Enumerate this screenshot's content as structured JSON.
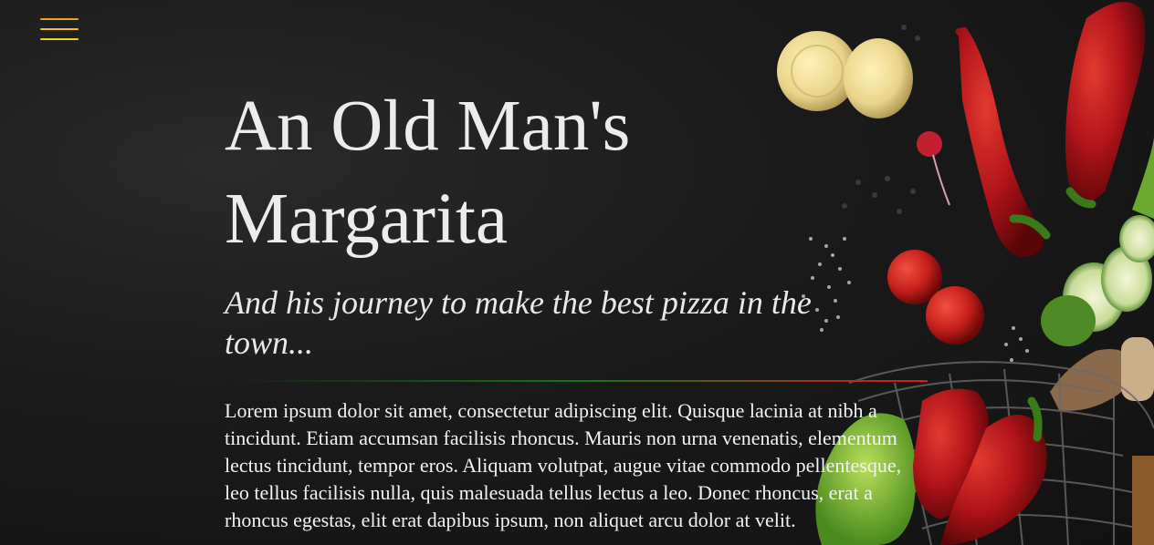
{
  "hero": {
    "title_line1": "An Old Man's",
    "title_line2": "Margarita",
    "subtitle": "And his journey to make the best pizza in the town...",
    "body": "Lorem ipsum dolor sit amet, consectetur adipiscing elit. Quisque lacinia at nibh a tincidunt. Etiam accumsan facilisis rhoncus. Mauris non urna venenatis, elementum lectus tincidunt, tempor eros. Aliquam volutpat, augue vitae commodo pellentesque, leo tellus facilisis nulla, quis malesuada tellus lectus a leo. Donec rhoncus, erat a rhoncus egestas, elit erat dapibus ipsum, non aliquet arcu dolor at velit."
  },
  "menu": {
    "icon": "hamburger-menu-icon"
  },
  "colors": {
    "background": "#161616",
    "text": "#ececec",
    "menu_top": "#f0a020",
    "menu_middle": "#f6c02a",
    "menu_bottom": "#f2d020",
    "divider_green": "#0f7a12",
    "divider_red": "#e01818",
    "pepper_red": "#b0141a",
    "tomato_red": "#c8201c",
    "zucchini_green": "#5f9a2a",
    "corn_yellow": "#e9d48a"
  }
}
